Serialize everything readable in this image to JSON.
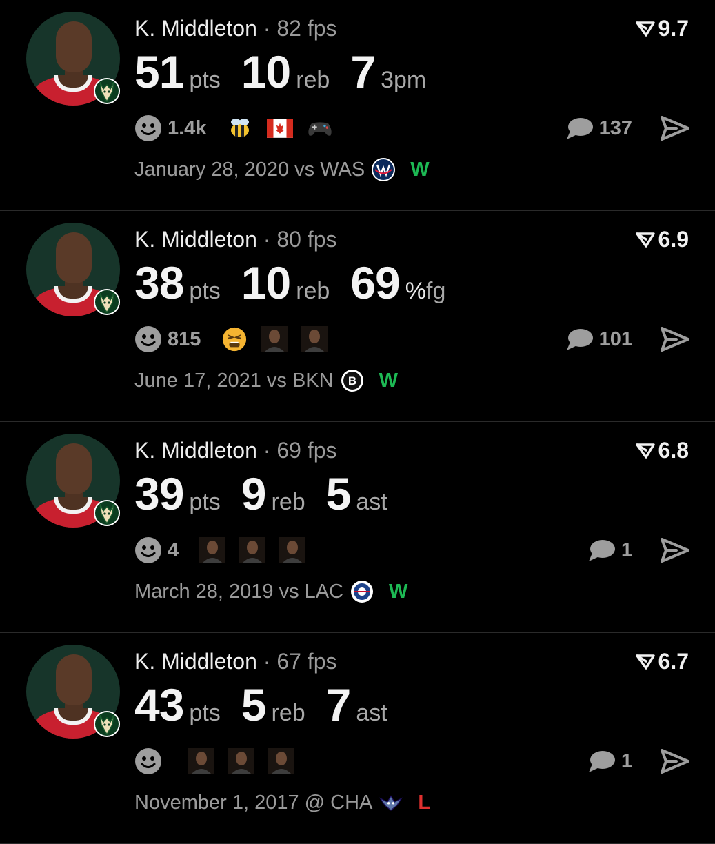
{
  "colors": {
    "background": "#000000",
    "win": "#1db954",
    "loss": "#e0302f",
    "muted": "#9a9a9a",
    "avatar_bg": "#17352a"
  },
  "posts": [
    {
      "player": "K. Middleton",
      "separator": "·",
      "fps": "82 fps",
      "rating": "9.7",
      "stats": [
        {
          "value": "51",
          "unit": "pts"
        },
        {
          "value": "10",
          "unit": "reb"
        },
        {
          "value": "7",
          "unit": "3pm"
        }
      ],
      "reaction_count": "1.4k",
      "stickers": [
        "bee-emoji",
        "canada-flag-emoji",
        "game-controller-emoji"
      ],
      "comment_count": "137",
      "game": "January 28, 2020 vs WAS",
      "team_logo": "wizards-logo",
      "result": "W"
    },
    {
      "player": "K. Middleton",
      "separator": "·",
      "fps": "80 fps",
      "rating": "6.9",
      "stats": [
        {
          "value": "38",
          "unit": "pts"
        },
        {
          "value": "10",
          "unit": "reb"
        },
        {
          "value": "69",
          "pct": "%",
          "unit": "fg"
        }
      ],
      "reaction_count": "815",
      "stickers": [
        "tired-face-emoji",
        "photo-sticker",
        "photo-sticker"
      ],
      "comment_count": "101",
      "game": "June 17, 2021 vs BKN",
      "team_logo": "nets-logo",
      "result": "W"
    },
    {
      "player": "K. Middleton",
      "separator": "·",
      "fps": "69 fps",
      "rating": "6.8",
      "stats": [
        {
          "value": "39",
          "unit": "pts"
        },
        {
          "value": "9",
          "unit": "reb"
        },
        {
          "value": "5",
          "unit": "ast"
        }
      ],
      "reaction_count": "4",
      "stickers": [
        "photo-sticker",
        "photo-sticker",
        "photo-sticker"
      ],
      "comment_count": "1",
      "game": "March 28, 2019 vs LAC",
      "team_logo": "clippers-logo",
      "result": "W"
    },
    {
      "player": "K. Middleton",
      "separator": "·",
      "fps": "67 fps",
      "rating": "6.7",
      "stats": [
        {
          "value": "43",
          "unit": "pts"
        },
        {
          "value": "5",
          "unit": "reb"
        },
        {
          "value": "7",
          "unit": "ast"
        }
      ],
      "reaction_count": "",
      "stickers": [
        "photo-sticker",
        "photo-sticker",
        "photo-sticker"
      ],
      "comment_count": "1",
      "game": "November 1, 2017 @ CHA",
      "team_logo": "hornets-logo",
      "result": "L"
    }
  ]
}
